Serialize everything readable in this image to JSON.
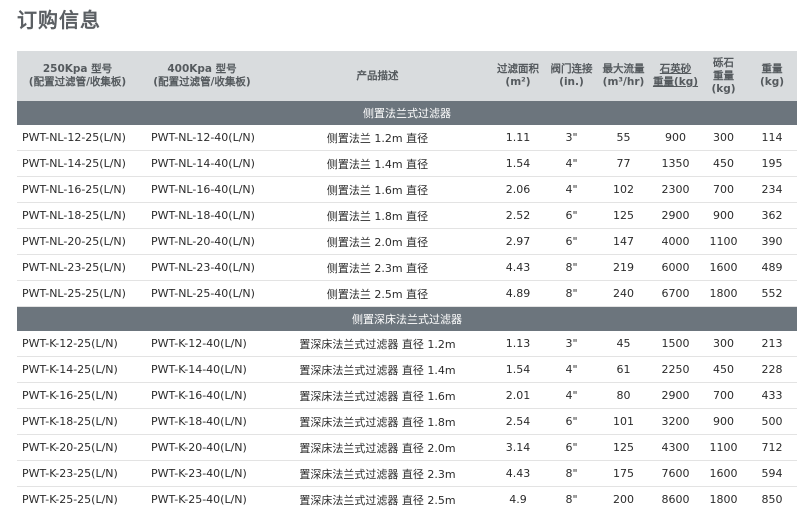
{
  "title": "订购信息",
  "headers": [
    {
      "l1": "250Kpa 型号",
      "l2": "(配置过滤管/收集板)"
    },
    {
      "l1": "400Kpa 型号",
      "l2": "(配置过滤管/收集板)"
    },
    {
      "l1": "产品描述"
    },
    {
      "l1": "过滤面积",
      "l2": "(m²)"
    },
    {
      "l1": "阀门连接",
      "l2": "(in.)"
    },
    {
      "l1": "最大流量",
      "l2": "(m³/hr)"
    },
    {
      "l1": "石英砂",
      "l2": "重量(kg)",
      "ul": true
    },
    {
      "l1": "砾石",
      "l2": "重量",
      "l3": "(kg)"
    },
    {
      "l1": "重量",
      "l2": "(kg)"
    }
  ],
  "sections": [
    {
      "label": "侧置法兰式过滤器",
      "rows": [
        [
          "PWT-NL-12-25(L/N)",
          "PWT-NL-12-40(L/N)",
          "侧置法兰 1.2m 直径",
          "1.11",
          "3\"",
          "55",
          "900",
          "300",
          "114"
        ],
        [
          "PWT-NL-14-25(L/N)",
          "PWT-NL-14-40(L/N)",
          "侧置法兰 1.4m 直径",
          "1.54",
          "4\"",
          "77",
          "1350",
          "450",
          "195"
        ],
        [
          "PWT-NL-16-25(L/N)",
          "PWT-NL-16-40(L/N)",
          "侧置法兰 1.6m 直径",
          "2.06",
          "4\"",
          "102",
          "2300",
          "700",
          "234"
        ],
        [
          "PWT-NL-18-25(L/N)",
          "PWT-NL-18-40(L/N)",
          "侧置法兰 1.8m 直径",
          "2.52",
          "6\"",
          "125",
          "2900",
          "900",
          "362"
        ],
        [
          "PWT-NL-20-25(L/N)",
          "PWT-NL-20-40(L/N)",
          "侧置法兰 2.0m 直径",
          "2.97",
          "6\"",
          "147",
          "4000",
          "1100",
          "390"
        ],
        [
          "PWT-NL-23-25(L/N)",
          "PWT-NL-23-40(L/N)",
          "侧置法兰 2.3m 直径",
          "4.43",
          "8\"",
          "219",
          "6000",
          "1600",
          "489"
        ],
        [
          "PWT-NL-25-25(L/N)",
          "PWT-NL-25-40(L/N)",
          "侧置法兰 2.5m 直径",
          "4.89",
          "8\"",
          "240",
          "6700",
          "1800",
          "552"
        ]
      ]
    },
    {
      "label": "侧置深床法兰式过滤器",
      "rows": [
        [
          "PWT-K-12-25(L/N)",
          "PWT-K-12-40(L/N)",
          "置深床法兰式过滤器 直径 1.2m",
          "1.13",
          "3\"",
          "45",
          "1500",
          "300",
          "213"
        ],
        [
          "PWT-K-14-25(L/N)",
          "PWT-K-14-40(L/N)",
          "置深床法兰式过滤器 直径 1.4m",
          "1.54",
          "4\"",
          "61",
          "2250",
          "450",
          "228"
        ],
        [
          "PWT-K-16-25(L/N)",
          "PWT-K-16-40(L/N)",
          "置深床法兰式过滤器 直径 1.6m",
          "2.01",
          "4\"",
          "80",
          "2900",
          "700",
          "433"
        ],
        [
          "PWT-K-18-25(L/N)",
          "PWT-K-18-40(L/N)",
          "置深床法兰式过滤器 直径 1.8m",
          "2.54",
          "6\"",
          "101",
          "3200",
          "900",
          "500"
        ],
        [
          "PWT-K-20-25(L/N)",
          "PWT-K-20-40(L/N)",
          "置深床法兰式过滤器 直径 2.0m",
          "3.14",
          "6\"",
          "125",
          "4300",
          "1100",
          "712"
        ],
        [
          "PWT-K-23-25(L/N)",
          "PWT-K-23-40(L/N)",
          "置深床法兰式过滤器 直径 2.3m",
          "4.43",
          "8\"",
          "175",
          "7600",
          "1600",
          "594"
        ],
        [
          "PWT-K-25-25(L/N)",
          "PWT-K-25-40(L/N)",
          "置深床法兰式过滤器 直径 2.5m",
          "4.9",
          "8\"",
          "200",
          "8600",
          "1800",
          "850"
        ]
      ]
    }
  ]
}
